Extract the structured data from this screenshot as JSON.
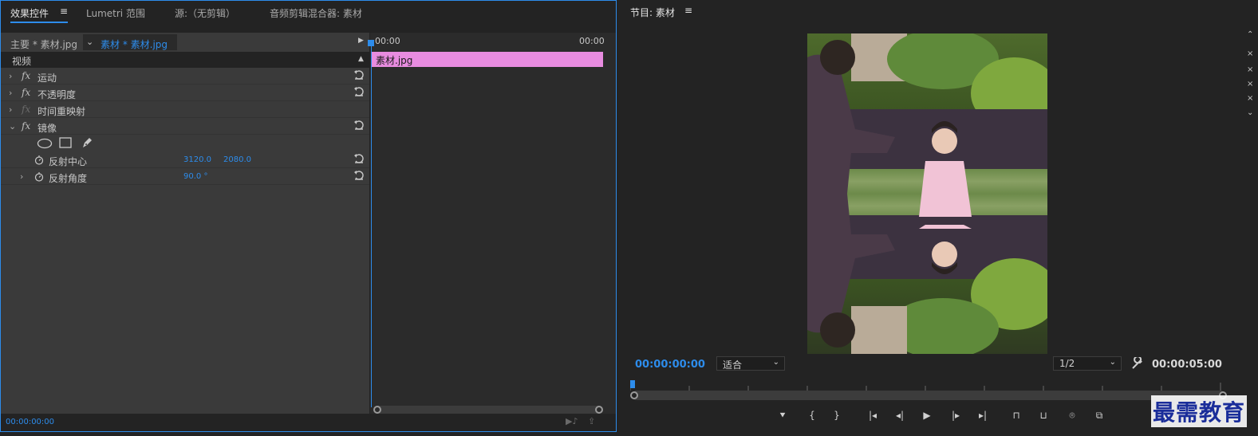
{
  "left_tabs": {
    "effect_controls": "效果控件",
    "menu": "≡",
    "lumetri": "Lumetri 范围",
    "source": "源:（无剪辑）",
    "audio_mixer": "音频剪辑混合器: 素材"
  },
  "effect_controls": {
    "master": "主要 * 素材.jpg",
    "clip": "素材 * 素材.jpg",
    "video_section": "视频",
    "effects": [
      {
        "label": "运动",
        "expanded": false
      },
      {
        "label": "不透明度",
        "expanded": false
      },
      {
        "label": "时间重映射",
        "expanded": false
      },
      {
        "label": "镜像",
        "expanded": true
      }
    ],
    "params": [
      {
        "label": "反射中心",
        "values": [
          "3120.0",
          "2080.0"
        ]
      },
      {
        "label": "反射角度",
        "values": [
          "90.0 °"
        ]
      }
    ],
    "timeline": {
      "start": "00:00",
      "end": "00:00",
      "clip_label": "素材.jpg",
      "clip_color": "#e88ce0"
    },
    "footer_timecode": "00:00:00:00"
  },
  "program": {
    "title": "节目: 素材",
    "menu": "≡",
    "current_timecode": "00:00:00:00",
    "zoom": "适合",
    "resolution": "1/2",
    "duration": "00:00:05:00"
  },
  "watermark": "最需教育",
  "colors": {
    "accent": "#2d8ceb",
    "panel": "#232323",
    "controls": "#3a3a3a"
  }
}
